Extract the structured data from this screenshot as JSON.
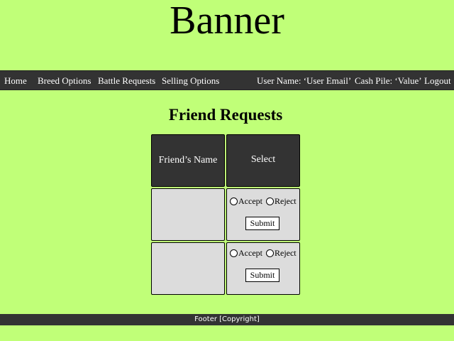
{
  "banner": {
    "text": "Banner"
  },
  "nav": {
    "home": "Home",
    "breed_options": "Breed Options",
    "battle_requests": "Battle Requests",
    "selling_options": "Selling Options",
    "user_name": "User Name: ‘User Email’",
    "cash_pile": "Cash Pile: ‘Value’",
    "logout": "Logout"
  },
  "main": {
    "title": "Friend Requests",
    "table": {
      "headers": [
        "Friend’s Name",
        "Select"
      ],
      "rows": [
        {
          "friend_name": "",
          "accept_label": "Accept",
          "reject_label": "Reject",
          "submit_label": "Submit"
        },
        {
          "friend_name": "",
          "accept_label": "Accept",
          "reject_label": "Reject",
          "submit_label": "Submit"
        }
      ]
    }
  },
  "footer": {
    "text": "Footer [Copyright]"
  },
  "colors": {
    "background": "#c0ff78",
    "bar": "#333333",
    "cell": "#dcdcdc"
  }
}
